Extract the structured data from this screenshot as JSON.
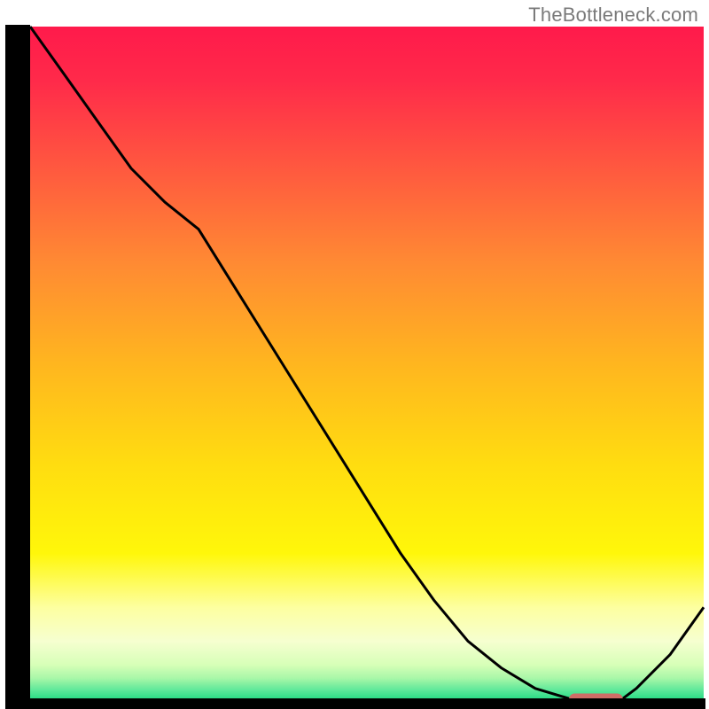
{
  "attribution": "TheBottleneck.com",
  "chart_data": {
    "type": "line",
    "x": [
      0.0,
      0.05,
      0.1,
      0.15,
      0.2,
      0.25,
      0.3,
      0.35,
      0.4,
      0.45,
      0.5,
      0.55,
      0.6,
      0.65,
      0.7,
      0.75,
      0.8,
      0.82,
      0.84,
      0.86,
      0.88,
      0.9,
      0.95,
      1.0
    ],
    "y": [
      1.0,
      0.93,
      0.86,
      0.79,
      0.74,
      0.7,
      0.62,
      0.54,
      0.46,
      0.38,
      0.3,
      0.22,
      0.15,
      0.09,
      0.05,
      0.02,
      0.005,
      0.003,
      0.003,
      0.003,
      0.005,
      0.02,
      0.07,
      0.14
    ],
    "flat_segment": {
      "x_start": 0.8,
      "x_end": 0.88,
      "y": 0.004
    },
    "xlim": [
      0,
      1
    ],
    "ylim": [
      0,
      1
    ],
    "title": "",
    "xlabel": "",
    "ylabel": ""
  },
  "gradient_stops": [
    {
      "offset": 0.0,
      "color": "#ff1a4b"
    },
    {
      "offset": 0.08,
      "color": "#ff2a4a"
    },
    {
      "offset": 0.2,
      "color": "#ff5540"
    },
    {
      "offset": 0.35,
      "color": "#ff8a33"
    },
    {
      "offset": 0.5,
      "color": "#ffb61f"
    },
    {
      "offset": 0.65,
      "color": "#ffdd10"
    },
    {
      "offset": 0.78,
      "color": "#fff70a"
    },
    {
      "offset": 0.86,
      "color": "#fdffa0"
    },
    {
      "offset": 0.91,
      "color": "#f6ffd0"
    },
    {
      "offset": 0.945,
      "color": "#d7ffb8"
    },
    {
      "offset": 0.965,
      "color": "#a8f7a8"
    },
    {
      "offset": 0.982,
      "color": "#60e89a"
    },
    {
      "offset": 1.0,
      "color": "#19d87f"
    }
  ],
  "marker_color": "#cf6d67",
  "frame_color": "#000000",
  "line_color": "#000000"
}
